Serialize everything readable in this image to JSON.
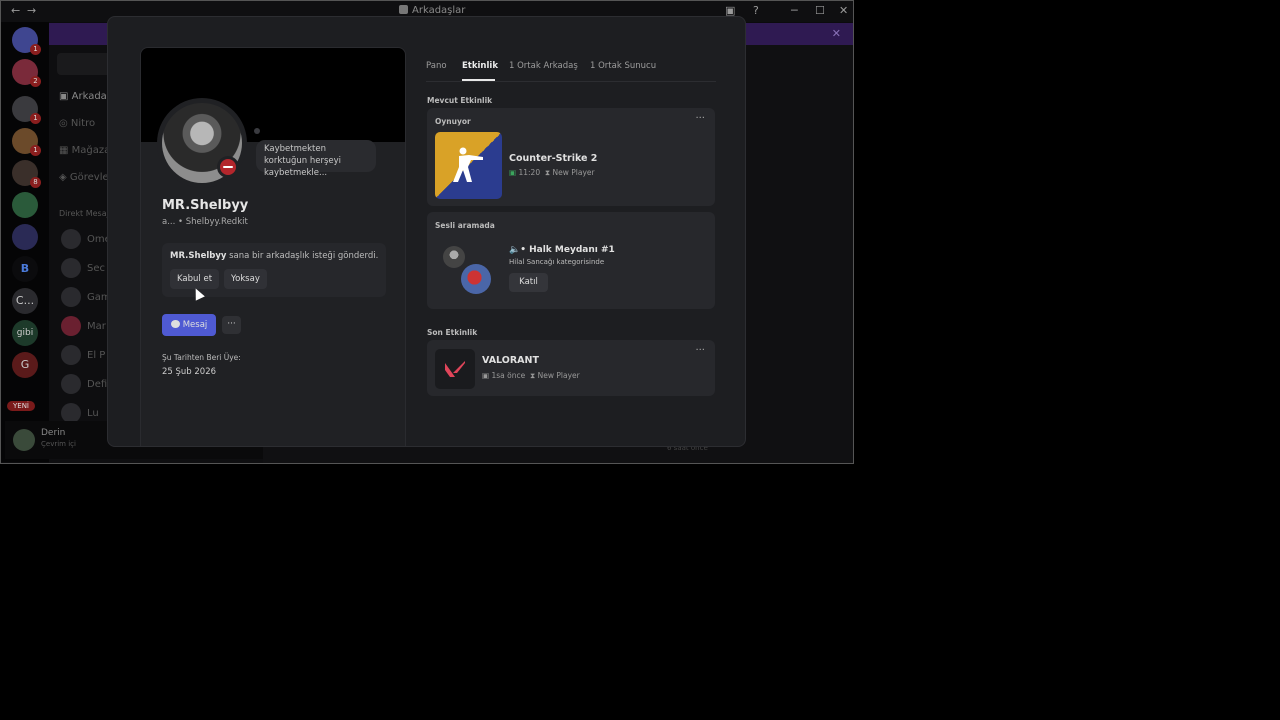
{
  "window": {
    "title": "Arkadaşlar",
    "controls": [
      "←",
      "→",
      "─",
      "☐",
      "✕"
    ]
  },
  "background": {
    "channels": [
      "Arkadaşlar",
      "Nitro",
      "Mağaza",
      "Görevler"
    ],
    "dm_header": "Direkt Mesajlar",
    "dms": [
      "Ome",
      "Sec",
      "Gam",
      "Mar",
      "El P",
      "Defi",
      "Lu"
    ],
    "guild_labels": [
      "B",
      "C...",
      "gibi",
      "G"
    ],
    "new_badge": "YENİ",
    "user": {
      "name": "Derin",
      "status": "Çevrim içi"
    },
    "footer_note": "6 saat önce"
  },
  "profile": {
    "display_name": "MR.Shelbyy",
    "username_line": "a... • Shelbyy.Redkit",
    "status_bubble": "Kaybetmekten korktuğun herşeyi kaybetmekle...",
    "friend_request": {
      "name": "MR.Shelbyy",
      "text": " sana bir arkadaşlık isteği gönderdi.",
      "accept_label": "Kabul et",
      "ignore_label": "Yoksay"
    },
    "message_label": "Mesaj",
    "more_label": "···",
    "member_since_label": "Şu Tarihten Beri Üye:",
    "member_since_date": "25 Şub 2026"
  },
  "tabs": [
    {
      "label": "Pano",
      "active": false
    },
    {
      "label": "Etkinlik",
      "active": true
    },
    {
      "label": "1 Ortak Arkadaş",
      "active": false
    },
    {
      "label": "1 Ortak Sunucu",
      "active": false
    }
  ],
  "current_activity": {
    "section_label": "Mevcut Etkinlik",
    "playing": {
      "label": "Oynuyor",
      "game": "Counter-Strike 2",
      "time": "11:20",
      "rank": "New Player",
      "more": "···"
    },
    "voice": {
      "label": "Sesli aramada",
      "channel": "• Halk Meydanı #1",
      "category": "Hilal Sancağı kategorisinde",
      "join_label": "Katıl"
    }
  },
  "recent_activity": {
    "section_label": "Son Etkinlik",
    "game": "VALORANT",
    "time": "1sa önce",
    "rank": "New Player",
    "more": "···"
  },
  "colors": {
    "accent": "#5865f2",
    "dnd": "#b3262c",
    "online": "#3ba55d"
  }
}
